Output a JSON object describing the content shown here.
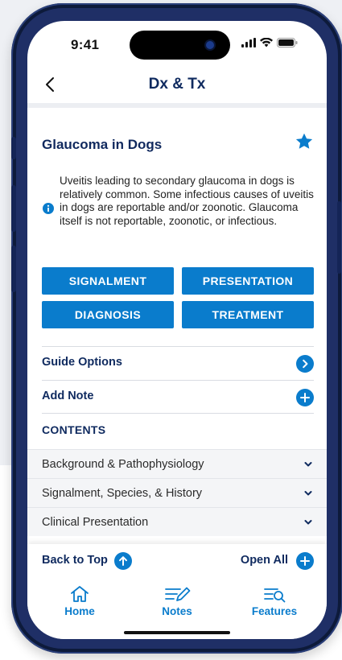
{
  "status_bar": {
    "time": "9:41"
  },
  "nav": {
    "title": "Dx & Tx"
  },
  "guide": {
    "title": "Glaucoma in Dogs",
    "info_text": "Uveitis leading to secondary glaucoma in dogs is relatively common. Some infectious causes of uveitis in dogs are reportable and/or zoonotic. Glaucoma itself is not reportable, zoonotic, or infectious."
  },
  "sections": {
    "signalment": "SIGNALMENT",
    "presentation": "PRESENTATION",
    "diagnosis": "DIAGNOSIS",
    "treatment": "TREATMENT"
  },
  "options": {
    "guide_options": "Guide Options",
    "add_note": "Add Note"
  },
  "contents": {
    "heading": "CONTENTS",
    "items": [
      {
        "label": "Background & Pathophysiology"
      },
      {
        "label": "Signalment, Species, & History"
      },
      {
        "label": "Clinical Presentation"
      }
    ]
  },
  "footer_actions": {
    "back_to_top": "Back to Top",
    "open_all": "Open All"
  },
  "tabs": [
    {
      "label": "Home",
      "icon": "home-icon"
    },
    {
      "label": "Notes",
      "icon": "notes-icon"
    },
    {
      "label": "Features",
      "icon": "features-icon"
    }
  ],
  "colors": {
    "accent_blue": "#0a7ccc",
    "navy_text": "#0f2a5f",
    "phone_frame": "#1f2f66"
  }
}
